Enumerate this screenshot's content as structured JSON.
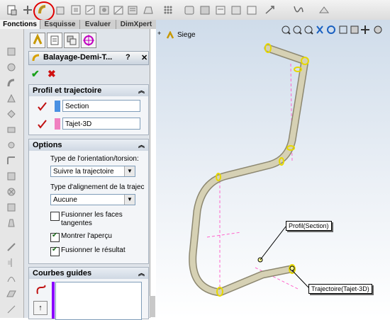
{
  "toolbar": {
    "icons": [
      "new-part-icon",
      "sketch-snap-icon",
      "sweep-boss-icon",
      "extrude-icon",
      "revolve-icon",
      "loft-icon",
      "shell-icon",
      "rib-icon",
      "fillet-icon",
      "pattern-icon",
      "feature-icon",
      "mirror-icon",
      "ref-geometry-icon",
      "curves-icon",
      "instant3d-icon"
    ],
    "highlighted": "sweep-boss-icon"
  },
  "tabs": [
    {
      "label": "Fonctions",
      "active": true
    },
    {
      "label": "Esquisse",
      "active": false
    },
    {
      "label": "Evaluer",
      "active": false
    },
    {
      "label": "DimXpert",
      "active": false
    }
  ],
  "property_manager": {
    "title": "Balayage-Demi-T...",
    "help": "?",
    "pin": "✕",
    "ok": "✔",
    "cancel": "✖",
    "profile_group": {
      "title": "Profil et trajectoire",
      "section_value": "Section",
      "path_value": "Tajet-3D",
      "section_color": "#4a90e2",
      "path_color": "#f080c0"
    },
    "options_group": {
      "title": "Options",
      "orientation_label": "Type de l'orientation/torsion:",
      "orientation_value": "Suivre la trajectoire",
      "alignment_label": "Type d'alignement de la trajec",
      "alignment_value": "Aucune",
      "merge_tangent_label_1": "Fusionner les faces",
      "merge_tangent_label_2": "tangentes",
      "merge_tangent_checked": false,
      "show_preview_label": "Montrer l'aperçu",
      "show_preview_checked": true,
      "merge_result_label": "Fusionner le résultat",
      "merge_result_checked": true
    },
    "guide_group": {
      "title": "Courbes guides",
      "list_color": "#8a00ff"
    }
  },
  "graphics": {
    "tree_item": "Siege",
    "callout_profile": "Profil(Section)",
    "callout_path": "Trajectoire(Tajet-3D)",
    "tube_color": "#c9c3a4",
    "marker_color": "#ffff00"
  }
}
